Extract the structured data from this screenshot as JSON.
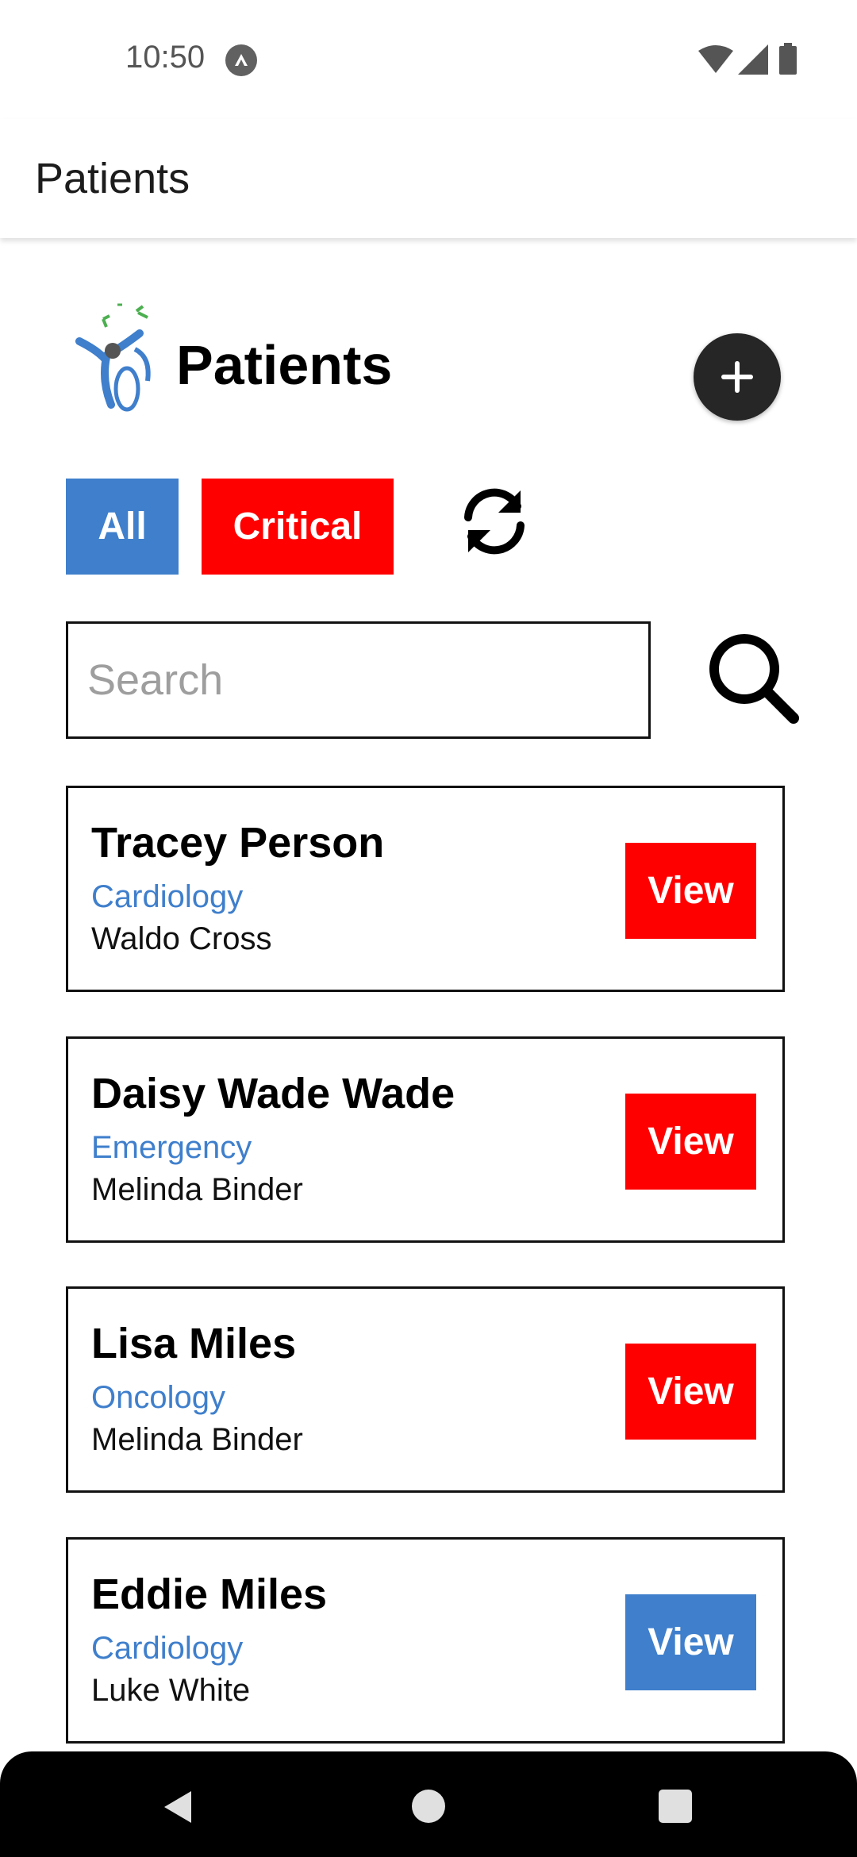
{
  "status_bar": {
    "time": "10:50",
    "icons": [
      "app-notification-icon",
      "wifi-icon",
      "signal-icon",
      "battery-icon"
    ]
  },
  "app_bar": {
    "title": "Patients"
  },
  "header": {
    "title": "Patients",
    "logo": "hospital-logo",
    "add_icon": "plus-icon"
  },
  "filters": {
    "all_label": "All",
    "critical_label": "Critical",
    "refresh_icon": "refresh-icon"
  },
  "search": {
    "placeholder": "Search",
    "value": "",
    "search_icon": "search-icon"
  },
  "patients": [
    {
      "name": "Tracey Person",
      "department": "Cardiology",
      "doctor": "Waldo Cross",
      "view_label": "View",
      "critical": true
    },
    {
      "name": "Daisy Wade Wade",
      "department": "Emergency",
      "doctor": "Melinda Binder",
      "view_label": "View",
      "critical": true
    },
    {
      "name": "Lisa Miles",
      "department": "Oncology",
      "doctor": "Melinda Binder",
      "view_label": "View",
      "critical": true
    },
    {
      "name": "Eddie Miles",
      "department": "Cardiology",
      "doctor": "Luke White",
      "view_label": "View",
      "critical": false
    }
  ],
  "colors": {
    "primary_blue": "#3f7fcc",
    "critical_red": "#ff0000",
    "fab_dark": "#262626"
  },
  "nav_bar": {
    "icons": [
      "back-icon",
      "home-icon",
      "recents-icon"
    ]
  }
}
